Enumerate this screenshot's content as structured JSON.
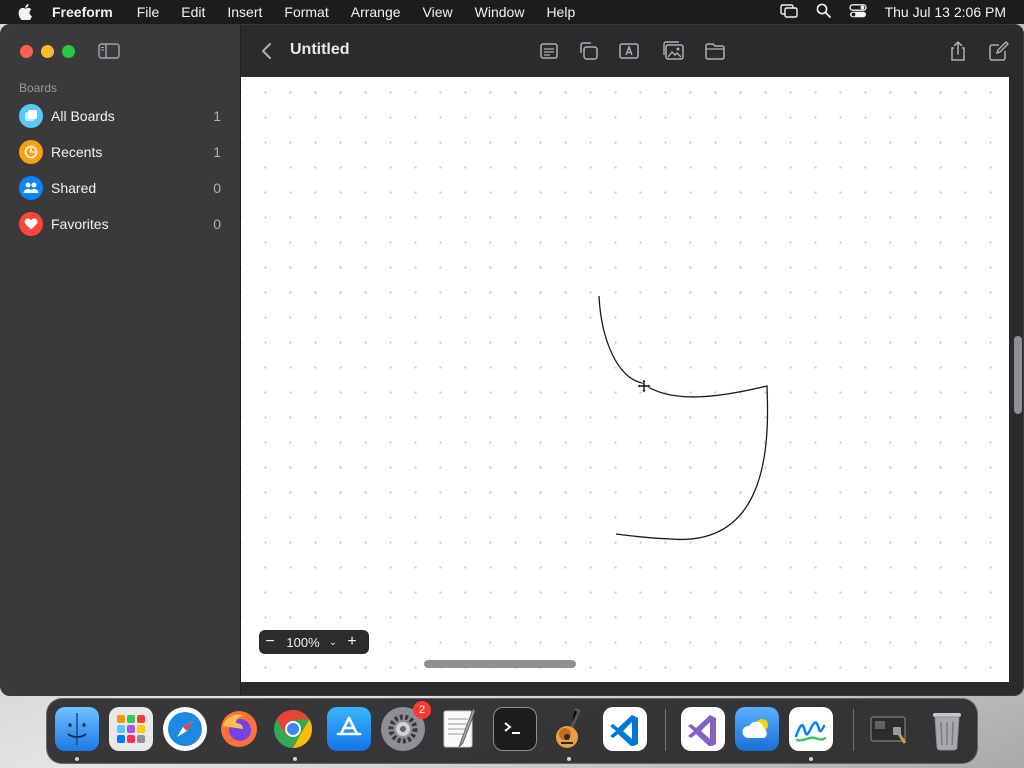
{
  "menubar": {
    "app_name": "Freeform",
    "items": [
      "File",
      "Edit",
      "Insert",
      "Format",
      "Arrange",
      "View",
      "Window",
      "Help"
    ],
    "clock": "Thu Jul 13  2:06 PM"
  },
  "sidebar": {
    "section_label": "Boards",
    "items": [
      {
        "label": "All Boards",
        "count": "1",
        "icon": "boards-icon",
        "color": "#5ac8fa"
      },
      {
        "label": "Recents",
        "count": "1",
        "icon": "clock-icon",
        "color": "#ff9f0a"
      },
      {
        "label": "Shared",
        "count": "0",
        "icon": "people-icon",
        "color": "#0a84ff"
      },
      {
        "label": "Favorites",
        "count": "0",
        "icon": "heart-icon",
        "color": "#ff453a"
      }
    ]
  },
  "toolbar": {
    "title": "Untitled"
  },
  "zoom": {
    "value": "100%"
  },
  "dock": {
    "settings_badge": "2"
  }
}
